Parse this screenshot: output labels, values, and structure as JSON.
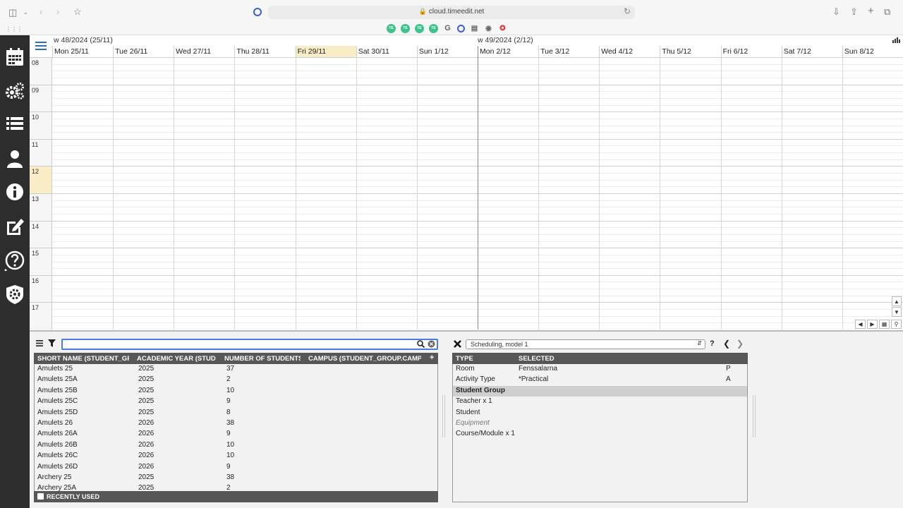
{
  "browser": {
    "url": "cloud.timeedit.net",
    "extensions": [
      "TE",
      "TE",
      "TE",
      "TE",
      "G"
    ]
  },
  "calendar": {
    "weeks": [
      {
        "label": "w 48/2024 (25/11)"
      },
      {
        "label": "w 49/2024 (2/12)"
      }
    ],
    "days": [
      "Mon 25/11",
      "Tue 26/11",
      "Wed 27/11",
      "Thu 28/11",
      "Fri 29/11",
      "Sat 30/11",
      "Sun 1/12",
      "Mon 2/12",
      "Tue 3/12",
      "Wed 4/12",
      "Thu 5/12",
      "Fri 6/12",
      "Sat 7/12",
      "Sun 8/12"
    ],
    "today_index": 4,
    "hours": [
      "08",
      "09",
      "10",
      "11",
      "12",
      "13",
      "14",
      "15",
      "16",
      "17"
    ],
    "highlight_hour": "12"
  },
  "object_list": {
    "columns": [
      "SHORT NAME (STUDENT_GRO...",
      "ACADEMIC YEAR (STUDE...",
      "NUMBER OF STUDENTS ...",
      "CAMPUS (STUDENT_GROUP.CAMPUS)"
    ],
    "add_label": "+",
    "rows": [
      [
        "Amulets 25",
        "2025",
        "37",
        ""
      ],
      [
        "Amulets 25A",
        "2025",
        "2",
        ""
      ],
      [
        "Amulets 25B",
        "2025",
        "10",
        ""
      ],
      [
        "Amulets 25C",
        "2025",
        "9",
        ""
      ],
      [
        "Amulets 25D",
        "2025",
        "8",
        ""
      ],
      [
        "Amulets 26",
        "2026",
        "38",
        ""
      ],
      [
        "Amulets 26A",
        "2026",
        "9",
        ""
      ],
      [
        "Amulets 26B",
        "2026",
        "10",
        ""
      ],
      [
        "Amulets 26C",
        "2026",
        "10",
        ""
      ],
      [
        "Amulets 26D",
        "2026",
        "9",
        ""
      ],
      [
        "Archery 25",
        "2025",
        "38",
        ""
      ],
      [
        "Archery 25A",
        "2025",
        "2",
        ""
      ]
    ],
    "recently_used_label": "RECENTLY USED"
  },
  "reservation": {
    "model": "Scheduling, model 1",
    "help_label": "?",
    "columns": [
      "TYPE",
      "SELECTED"
    ],
    "rows": [
      {
        "type": "Room",
        "selected": "Fenssalarna",
        "flag": "P",
        "style": "normal"
      },
      {
        "type": "Activity Type",
        "selected": "*Practical",
        "flag": "A",
        "style": "normal"
      },
      {
        "type": "Student Group",
        "selected": "",
        "flag": "",
        "style": "group"
      },
      {
        "type": "Teacher x 1",
        "selected": "",
        "flag": "",
        "style": "normal"
      },
      {
        "type": "Student",
        "selected": "",
        "flag": "",
        "style": "normal"
      },
      {
        "type": "Equipment",
        "selected": "",
        "flag": "",
        "style": "italic"
      },
      {
        "type": "Course/Module x 1",
        "selected": "",
        "flag": "",
        "style": "normal"
      }
    ]
  }
}
